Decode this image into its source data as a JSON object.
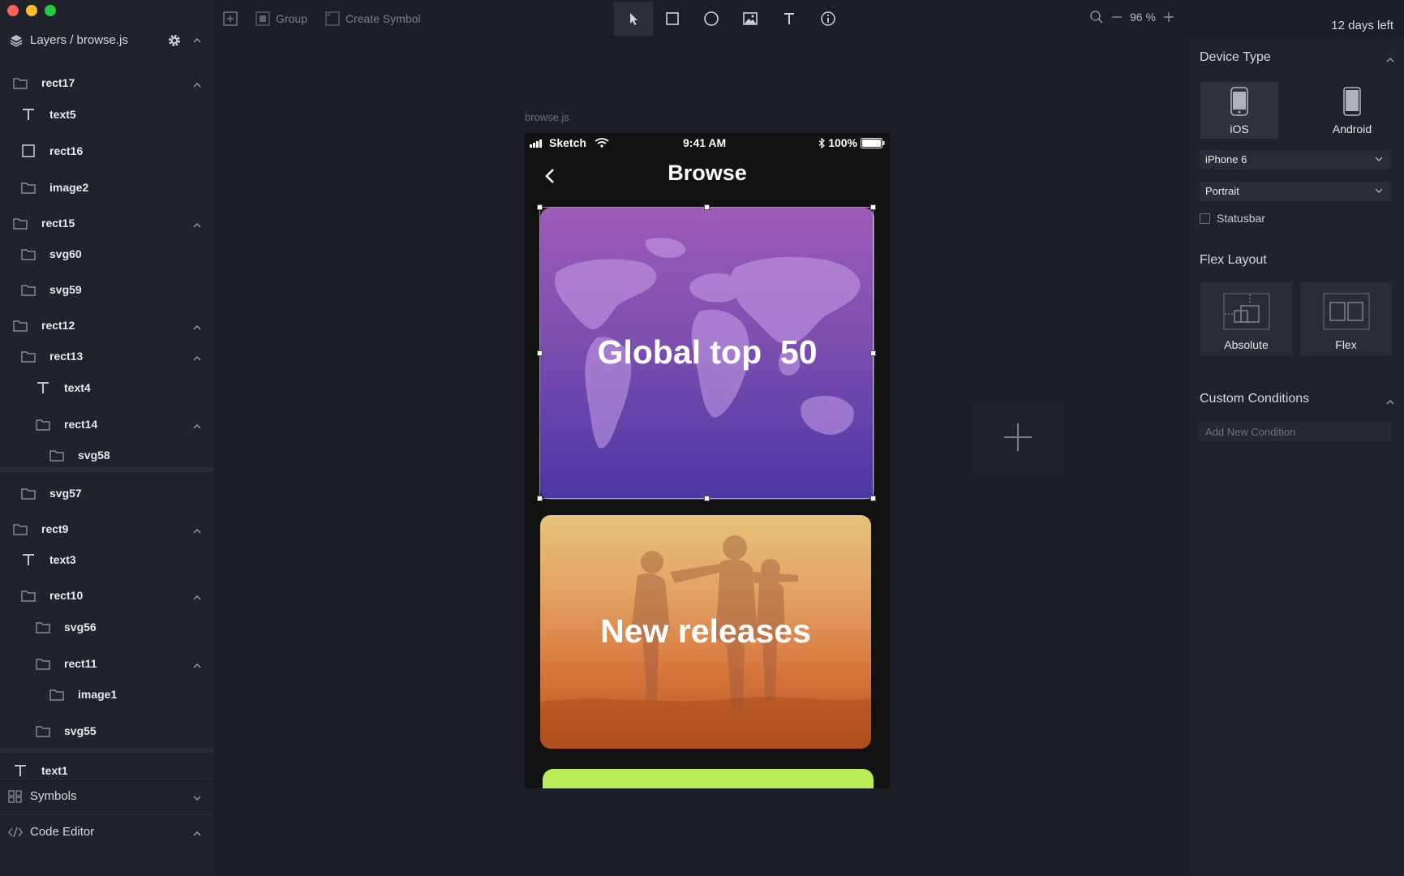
{
  "sidebar": {
    "title": "Layers / browse.js",
    "layers": [
      {
        "label": "rect17",
        "icon": "folder-icon",
        "collapsible": true
      },
      {
        "label": "text5",
        "icon": "text-icon",
        "collapsible": false
      },
      {
        "label": "rect16",
        "icon": "rect-icon",
        "collapsible": false
      },
      {
        "label": "image2",
        "icon": "folder-icon",
        "collapsible": false
      },
      {
        "label": "rect15",
        "icon": "folder-icon",
        "collapsible": true
      },
      {
        "label": "svg60",
        "icon": "folder-icon",
        "collapsible": false
      },
      {
        "label": "svg59",
        "icon": "folder-icon",
        "collapsible": false
      },
      {
        "label": "rect12",
        "icon": "folder-icon",
        "collapsible": true
      },
      {
        "label": "rect13",
        "icon": "folder-icon",
        "collapsible": true
      },
      {
        "label": "text4",
        "icon": "text-icon",
        "collapsible": false
      },
      {
        "label": "rect14",
        "icon": "folder-icon",
        "collapsible": true
      },
      {
        "label": "svg58",
        "icon": "folder-icon",
        "collapsible": false
      },
      {
        "label": "svg57",
        "icon": "folder-icon",
        "collapsible": false
      },
      {
        "label": "rect9",
        "icon": "folder-icon",
        "collapsible": true
      },
      {
        "label": "text3",
        "icon": "text-icon",
        "collapsible": false
      },
      {
        "label": "rect10",
        "icon": "folder-icon",
        "collapsible": true
      },
      {
        "label": "svg56",
        "icon": "folder-icon",
        "collapsible": false
      },
      {
        "label": "rect11",
        "icon": "folder-icon",
        "collapsible": true
      },
      {
        "label": "image1",
        "icon": "folder-icon",
        "collapsible": false
      },
      {
        "label": "svg55",
        "icon": "folder-icon",
        "collapsible": false
      },
      {
        "label": "text1",
        "icon": "text-icon",
        "collapsible": false
      }
    ],
    "symbols_label": "Symbols",
    "code_editor_label": "Code Editor"
  },
  "toolbar": {
    "group_label": "Group",
    "create_symbol_label": "Create Symbol",
    "tools": [
      "pointer-icon",
      "rectangle-icon",
      "oval-icon",
      "image-icon",
      "text-tool-icon",
      "info-icon"
    ],
    "zoom_level": "96 %",
    "trial_text": "12 days left"
  },
  "canvas": {
    "frame_name": "browse.js",
    "status": {
      "carrier": "Sketch",
      "time": "9:41 AM",
      "battery": "100%"
    },
    "nav_title": "Browse",
    "cards": {
      "global": "Global top  50",
      "new": "New releases"
    }
  },
  "inspector": {
    "device_type_title": "Device Type",
    "devices": [
      "iOS",
      "Android"
    ],
    "device_model": "iPhone 6",
    "orientation": "Portrait",
    "statusbar_label": "Statusbar",
    "flex_layout_title": "Flex Layout",
    "layouts": [
      "Absolute",
      "Flex"
    ],
    "custom_conditions_title": "Custom Conditions",
    "add_condition_placeholder": "Add New Condition"
  }
}
